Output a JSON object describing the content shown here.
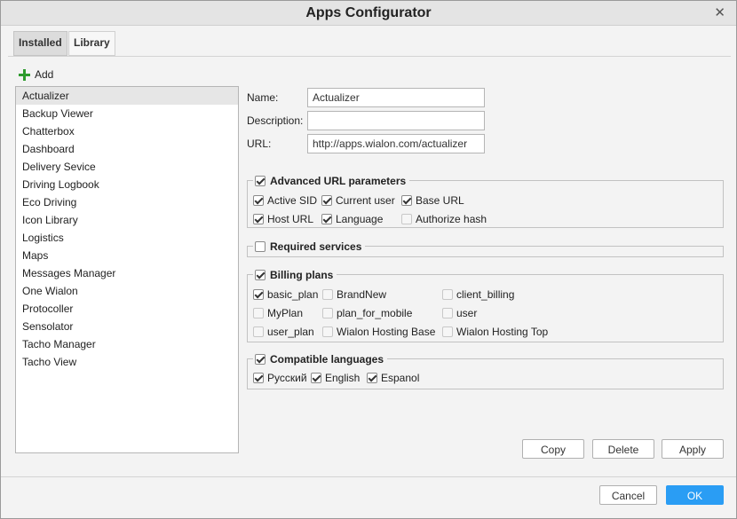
{
  "dialog": {
    "title": "Apps Configurator",
    "close_glyph": "✕"
  },
  "tabs": [
    {
      "label": "Installed",
      "active": true
    },
    {
      "label": "Library",
      "active": false
    }
  ],
  "add_label": "Add",
  "apps": [
    "Actualizer",
    "Backup Viewer",
    "Chatterbox",
    "Dashboard",
    "Delivery Sevice",
    "Driving Logbook",
    "Eco Driving",
    "Icon Library",
    "Logistics",
    "Maps",
    "Messages Manager",
    "One Wialon",
    "Protocoller",
    "Sensolator",
    "Tacho Manager",
    "Tacho View"
  ],
  "selected_app": "Actualizer",
  "form": {
    "name_label": "Name:",
    "name_value": "Actualizer",
    "description_label": "Description:",
    "description_value": "",
    "url_label": "URL:",
    "url_value": "http://apps.wialon.com/actualizer"
  },
  "advanced_url": {
    "title": "Advanced URL parameters",
    "checked": true,
    "options": [
      {
        "label": "Active SID",
        "checked": true
      },
      {
        "label": "Current user",
        "checked": true
      },
      {
        "label": "Base URL",
        "checked": true
      },
      {
        "label": "Host URL",
        "checked": true
      },
      {
        "label": "Language",
        "checked": true
      },
      {
        "label": "Authorize hash",
        "checked": false
      }
    ]
  },
  "required_services": {
    "title": "Required services",
    "checked": false
  },
  "billing_plans": {
    "title": "Billing plans",
    "checked": true,
    "options": [
      {
        "label": "basic_plan",
        "checked": true
      },
      {
        "label": "BrandNew",
        "checked": false
      },
      {
        "label": "client_billing",
        "checked": false
      },
      {
        "label": "MyPlan",
        "checked": false
      },
      {
        "label": "plan_for_mobile",
        "checked": false
      },
      {
        "label": "user",
        "checked": false
      },
      {
        "label": "user_plan",
        "checked": false
      },
      {
        "label": "Wialon Hosting Base",
        "checked": false
      },
      {
        "label": "Wialon Hosting Top",
        "checked": false
      }
    ]
  },
  "languages": {
    "title": "Compatible languages",
    "checked": true,
    "options": [
      {
        "label": "Русский",
        "checked": true
      },
      {
        "label": "English",
        "checked": true
      },
      {
        "label": "Espanol",
        "checked": true
      }
    ]
  },
  "actions": {
    "copy": "Copy",
    "delete": "Delete",
    "apply": "Apply"
  },
  "footer": {
    "cancel": "Cancel",
    "ok": "OK"
  },
  "colors": {
    "accent": "#2a9df4",
    "add_icon": "#2e9b2e",
    "selected_row": "#e6e6e6"
  }
}
